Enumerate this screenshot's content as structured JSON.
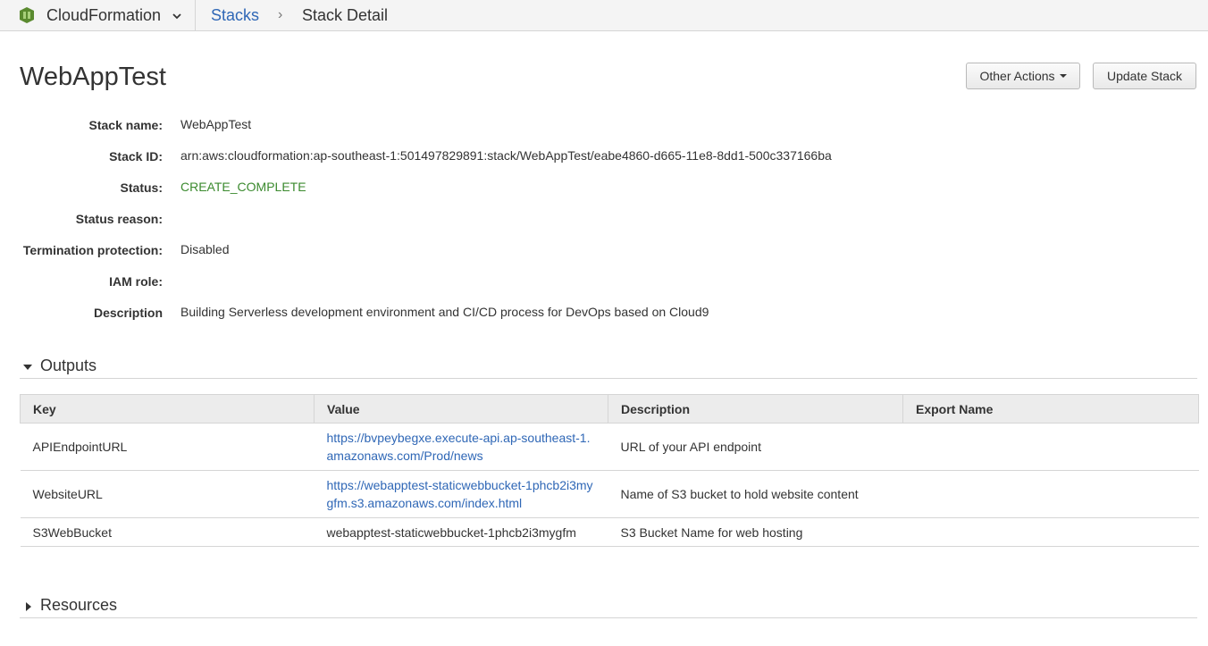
{
  "topbar": {
    "service_name": "CloudFormation",
    "logo_color": "#5a8a2f",
    "breadcrumb": {
      "link": "Stacks",
      "separator": "›",
      "current": "Stack Detail"
    }
  },
  "stack": {
    "title": "WebAppTest",
    "actions": {
      "other_actions": "Other Actions",
      "update_stack": "Update Stack"
    },
    "details": [
      {
        "label": "Stack name:",
        "value": "WebAppTest"
      },
      {
        "label": "Stack ID:",
        "value": "arn:aws:cloudformation:ap-southeast-1:501497829891:stack/WebAppTest/eabe4860-d665-11e8-8dd1-500c337166ba"
      },
      {
        "label": "Status:",
        "value": "CREATE_COMPLETE",
        "color": "#3b8a2e"
      },
      {
        "label": "Status reason:",
        "value": ""
      },
      {
        "label": "Termination protection:",
        "value": "Disabled"
      },
      {
        "label": "IAM role:",
        "value": ""
      },
      {
        "label": "Description",
        "value": "Building Serverless development environment and CI/CD process for DevOps based on Cloud9"
      }
    ]
  },
  "outputs": {
    "title": "Outputs",
    "columns": [
      "Key",
      "Value",
      "Description",
      "Export Name"
    ],
    "rows": [
      {
        "key": "APIEndpointURL",
        "value": "https://bvpeybegxe.execute-api.ap-southeast-1.amazonaws.com/Prod/news",
        "description": "URL of your API endpoint",
        "export_name": ""
      },
      {
        "key": "WebsiteURL",
        "value": "https://webapptest-staticwebbucket-1phcb2i3mygfm.s3.amazonaws.com/index.html",
        "description": "Name of S3 bucket to hold website content",
        "export_name": ""
      },
      {
        "key": "S3WebBucket",
        "value": "webapptest-staticwebbucket-1phcb2i3mygfm",
        "description": "S3 Bucket Name for web hosting",
        "export_name": ""
      }
    ]
  },
  "resources": {
    "title": "Resources"
  }
}
